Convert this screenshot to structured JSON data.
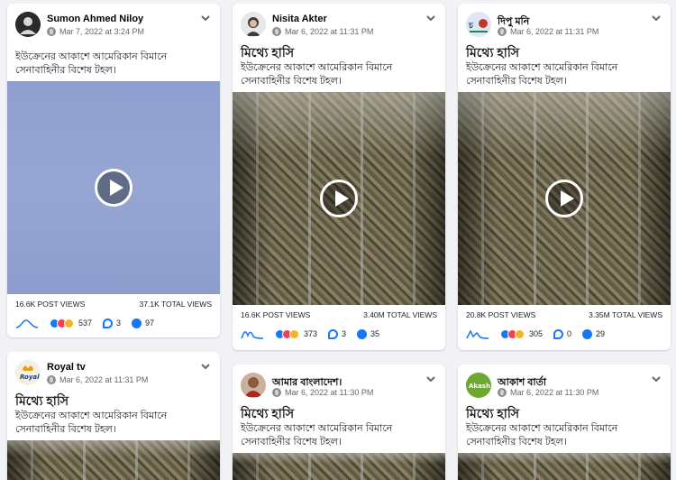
{
  "posts": [
    {
      "author": "Sumon Ahmed Niloy",
      "time": "Mar 7, 2022 at 3:24 PM",
      "title": "",
      "text": "ইউক্রেনের আকাশে আমেরিকান বিমানে সেনাবাহিনীর বিশেষ টহল।",
      "post_views": "16.6K POST VIEWS",
      "total_views": "37.1K TOTAL VIEWS",
      "reactions": "537",
      "comments": "3",
      "shares": "97",
      "media": "blue-sky-video"
    },
    {
      "author": "Nisita Akter",
      "time": "Mar 6, 2022 at 11:31 PM",
      "title": "মিথ্যে হাসি",
      "text": "ইউক্রেনের আকাশে আমেরিকান বিমানে সেনাবাহিনীর বিশেষ টহল।",
      "post_views": "16.6K POST VIEWS",
      "total_views": "3.40M TOTAL VIEWS",
      "reactions": "373",
      "comments": "3",
      "shares": "35",
      "media": "troops-video"
    },
    {
      "author": "দিপু মনি",
      "time": "Mar 6, 2022 at 11:31 PM",
      "title": "মিথ্যে হাসি",
      "text": "ইউক্রেনের আকাশে আমেরিকান বিমানে সেনাবাহিনীর বিশেষ টহল।",
      "post_views": "20.8K POST VIEWS",
      "total_views": "3.35M TOTAL VIEWS",
      "reactions": "305",
      "comments": "0",
      "shares": "29",
      "media": "troops-video"
    },
    {
      "author": "Royal tv",
      "time": "Mar 6, 2022 at 11:31 PM",
      "title": "মিথ্যে হাসি",
      "text": "ইউক্রেনের আকাশে আমেরিকান বিমানে সেনাবাহিনীর বিশেষ টহল।",
      "media": "troops-video"
    },
    {
      "author": "আমার বাংলাদেশ।",
      "time": "Mar 6, 2022 at 11:30 PM",
      "title": "মিথ্যে হাসি",
      "text": "ইউক্রেনের আকাশে আমেরিকান বিমানে সেনাবাহিনীর বিশেষ টহল।",
      "media": "troops-video"
    },
    {
      "author": "আকাশ বার্তা",
      "time": "Mar 6, 2022 at 11:30 PM",
      "title": "মিথ্যে হাসি",
      "text": "ইউক্রেনের আকাশে আমেরিকান বিমানে সেনাবাহিনীর বিশেষ টহল।",
      "avatar_text": "Akash",
      "media": "troops-video"
    }
  ],
  "avatar_colors": [
    "#2b2b2b",
    "#e8e8e8",
    "#dfe6f5",
    "#f4f0e1",
    "#c9b19b",
    "#6ca832"
  ],
  "royal_logo_text": "Royal"
}
